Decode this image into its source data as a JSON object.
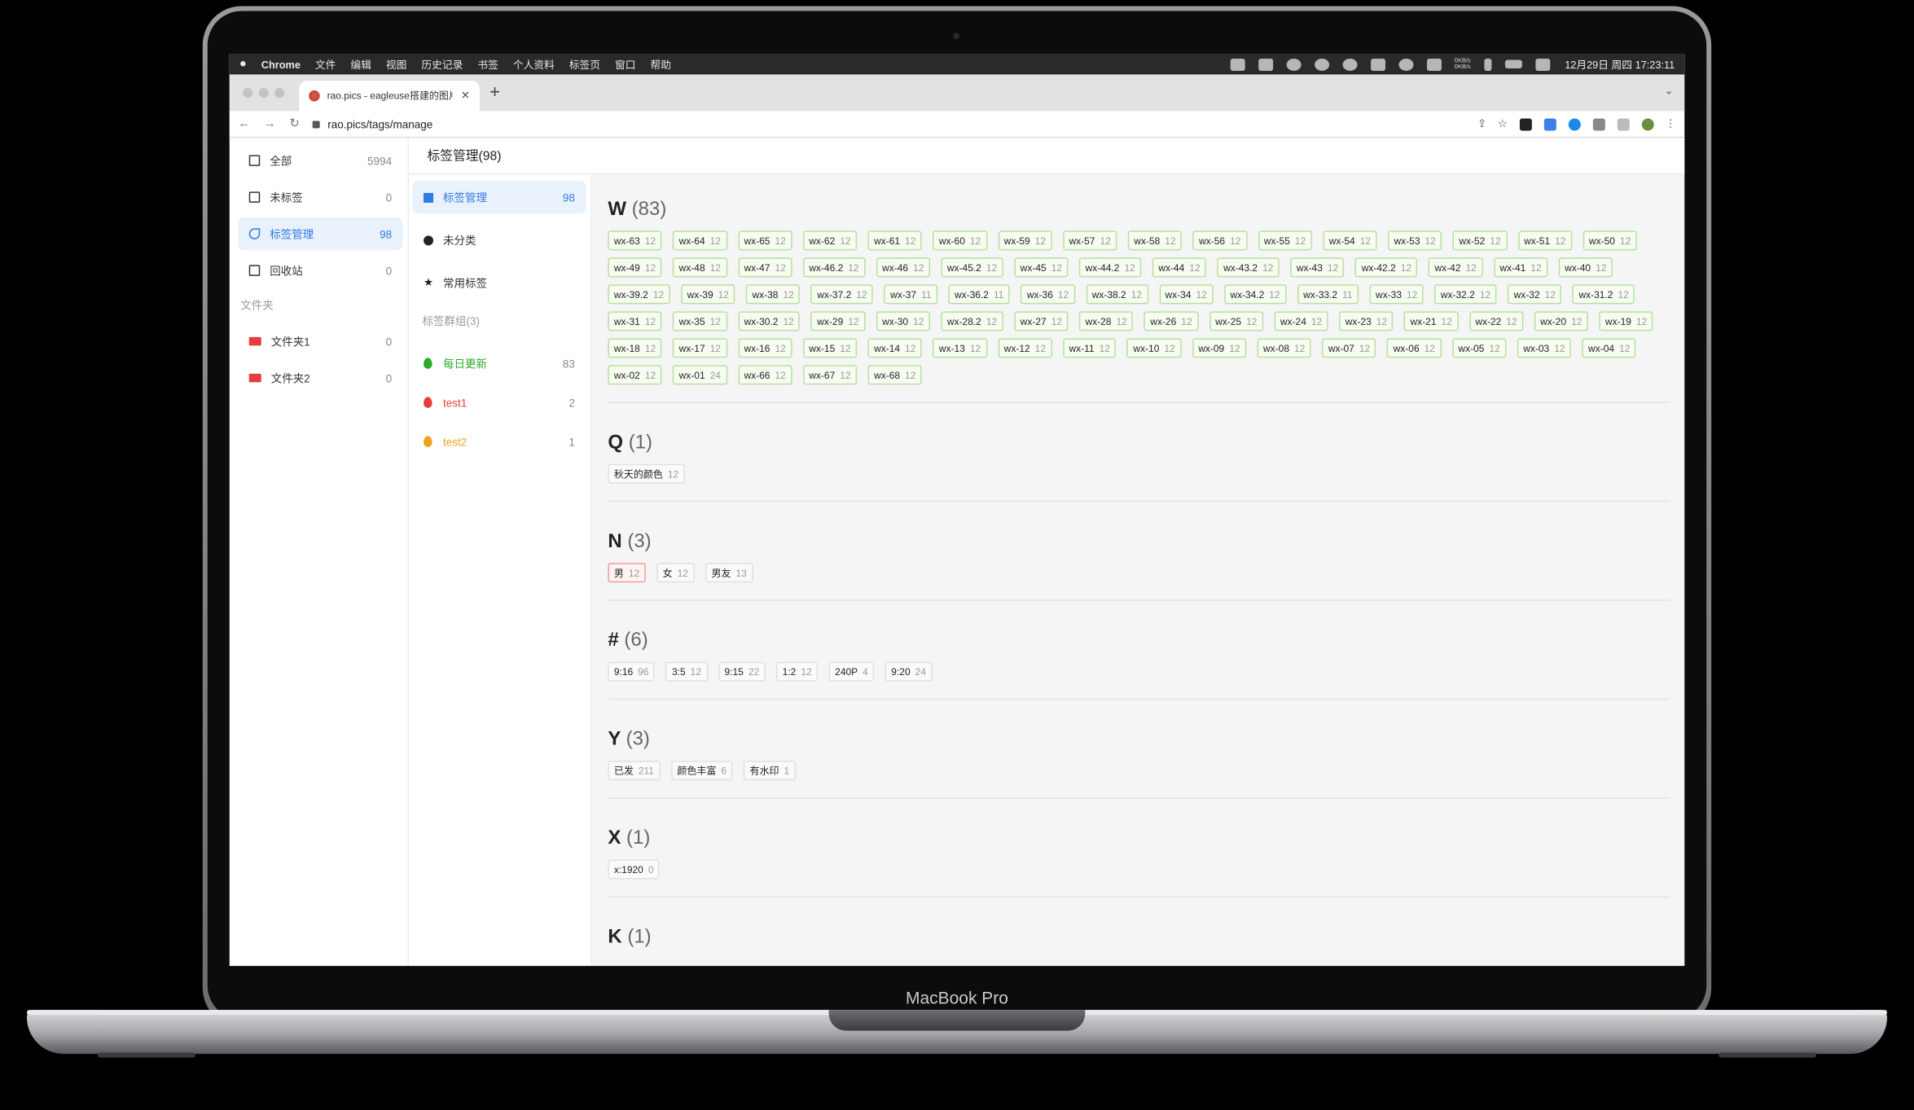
{
  "device_label": "MacBook Pro",
  "menubar": {
    "items": [
      "Chrome",
      "文件",
      "编辑",
      "视图",
      "历史记录",
      "书签",
      "个人资料",
      "标签页",
      "窗口",
      "帮助"
    ],
    "net_up": "0KB/s",
    "net_down": "0KB/s",
    "clock": "12月29日 周四  17:23:11"
  },
  "browser": {
    "tab_title": "rao.pics - eagleuse搭建的图片...",
    "url": "rao.pics/tags/manage"
  },
  "sidebar": {
    "items": [
      {
        "label": "全部",
        "count": "5994"
      },
      {
        "label": "未标签",
        "count": "0"
      },
      {
        "label": "标签管理",
        "count": "98"
      },
      {
        "label": "回收站",
        "count": "0"
      }
    ],
    "folders_label": "文件夹",
    "folders": [
      {
        "label": "文件夹1",
        "count": "0"
      },
      {
        "label": "文件夹2",
        "count": "0"
      }
    ]
  },
  "panel": {
    "title": "标签管理(98)",
    "items": [
      {
        "label": "标签管理",
        "count": "98"
      },
      {
        "label": "未分类"
      },
      {
        "label": "常用标签"
      }
    ],
    "groups_label": "标签群组(3)",
    "groups": [
      {
        "label": "每日更新",
        "count": "83",
        "color": "#2bab2b"
      },
      {
        "label": "test1",
        "count": "2",
        "color": "#e53d3d"
      },
      {
        "label": "test2",
        "count": "1",
        "color": "#f0a020"
      }
    ]
  },
  "sections": [
    {
      "letter": "W",
      "count": "(83)",
      "color": "green",
      "tags": [
        [
          "wx-63",
          "12"
        ],
        [
          "wx-64",
          "12"
        ],
        [
          "wx-65",
          "12"
        ],
        [
          "wx-62",
          "12"
        ],
        [
          "wx-61",
          "12"
        ],
        [
          "wx-60",
          "12"
        ],
        [
          "wx-59",
          "12"
        ],
        [
          "wx-57",
          "12"
        ],
        [
          "wx-58",
          "12"
        ],
        [
          "wx-56",
          "12"
        ],
        [
          "wx-55",
          "12"
        ],
        [
          "wx-54",
          "12"
        ],
        [
          "wx-53",
          "12"
        ],
        [
          "wx-52",
          "12"
        ],
        [
          "wx-51",
          "12"
        ],
        [
          "wx-50",
          "12"
        ],
        [
          "wx-49",
          "12"
        ],
        [
          "wx-48",
          "12"
        ],
        [
          "wx-47",
          "12"
        ],
        [
          "wx-46.2",
          "12"
        ],
        [
          "wx-46",
          "12"
        ],
        [
          "wx-45.2",
          "12"
        ],
        [
          "wx-45",
          "12"
        ],
        [
          "wx-44.2",
          "12"
        ],
        [
          "wx-44",
          "12"
        ],
        [
          "wx-43.2",
          "12"
        ],
        [
          "wx-43",
          "12"
        ],
        [
          "wx-42.2",
          "12"
        ],
        [
          "wx-42",
          "12"
        ],
        [
          "wx-41",
          "12"
        ],
        [
          "wx-40",
          "12"
        ],
        [
          "wx-39.2",
          "12"
        ],
        [
          "wx-39",
          "12"
        ],
        [
          "wx-38",
          "12"
        ],
        [
          "wx-37.2",
          "12"
        ],
        [
          "wx-37",
          "11"
        ],
        [
          "wx-36.2",
          "11"
        ],
        [
          "wx-36",
          "12"
        ],
        [
          "wx-38.2",
          "12"
        ],
        [
          "wx-34",
          "12"
        ],
        [
          "wx-34.2",
          "12"
        ],
        [
          "wx-33.2",
          "11"
        ],
        [
          "wx-33",
          "12"
        ],
        [
          "wx-32.2",
          "12"
        ],
        [
          "wx-32",
          "12"
        ],
        [
          "wx-31.2",
          "12"
        ],
        [
          "wx-31",
          "12"
        ],
        [
          "wx-35",
          "12"
        ],
        [
          "wx-30.2",
          "12"
        ],
        [
          "wx-29",
          "12"
        ],
        [
          "wx-30",
          "12"
        ],
        [
          "wx-28.2",
          "12"
        ],
        [
          "wx-27",
          "12"
        ],
        [
          "wx-28",
          "12"
        ],
        [
          "wx-26",
          "12"
        ],
        [
          "wx-25",
          "12"
        ],
        [
          "wx-24",
          "12"
        ],
        [
          "wx-23",
          "12"
        ],
        [
          "wx-21",
          "12"
        ],
        [
          "wx-22",
          "12"
        ],
        [
          "wx-20",
          "12"
        ],
        [
          "wx-19",
          "12"
        ],
        [
          "wx-18",
          "12"
        ],
        [
          "wx-17",
          "12"
        ],
        [
          "wx-16",
          "12"
        ],
        [
          "wx-15",
          "12"
        ],
        [
          "wx-14",
          "12"
        ],
        [
          "wx-13",
          "12"
        ],
        [
          "wx-12",
          "12"
        ],
        [
          "wx-11",
          "12"
        ],
        [
          "wx-10",
          "12"
        ],
        [
          "wx-09",
          "12"
        ],
        [
          "wx-08",
          "12"
        ],
        [
          "wx-07",
          "12"
        ],
        [
          "wx-06",
          "12"
        ],
        [
          "wx-05",
          "12"
        ],
        [
          "wx-03",
          "12"
        ],
        [
          "wx-04",
          "12"
        ],
        [
          "wx-02",
          "12"
        ],
        [
          "wx-01",
          "24"
        ],
        [
          "wx-66",
          "12"
        ],
        [
          "wx-67",
          "12"
        ],
        [
          "wx-68",
          "12"
        ]
      ]
    },
    {
      "letter": "Q",
      "count": "(1)",
      "color": "gray",
      "tags": [
        [
          "秋天的颜色",
          "12"
        ]
      ]
    },
    {
      "letter": "N",
      "count": "(3)",
      "color": "gray",
      "tags": [
        [
          "男",
          "12",
          "red"
        ],
        [
          "女",
          "12"
        ],
        [
          "男友",
          "13"
        ]
      ]
    },
    {
      "letter": "#",
      "count": "(6)",
      "color": "gray",
      "tags": [
        [
          "9:16",
          "96"
        ],
        [
          "3:5",
          "12"
        ],
        [
          "9:15",
          "22"
        ],
        [
          "1:2",
          "12"
        ],
        [
          "240P",
          "4"
        ],
        [
          "9:20",
          "24"
        ]
      ]
    },
    {
      "letter": "Y",
      "count": "(3)",
      "color": "gray",
      "tags": [
        [
          "已发",
          "211"
        ],
        [
          "颜色丰富",
          "6"
        ],
        [
          "有水印",
          "1"
        ]
      ]
    },
    {
      "letter": "X",
      "count": "(1)",
      "color": "gray",
      "tags": [
        [
          "x:1920",
          "0"
        ]
      ]
    },
    {
      "letter": "K",
      "count": "(1)",
      "color": "gray",
      "tags": []
    }
  ]
}
